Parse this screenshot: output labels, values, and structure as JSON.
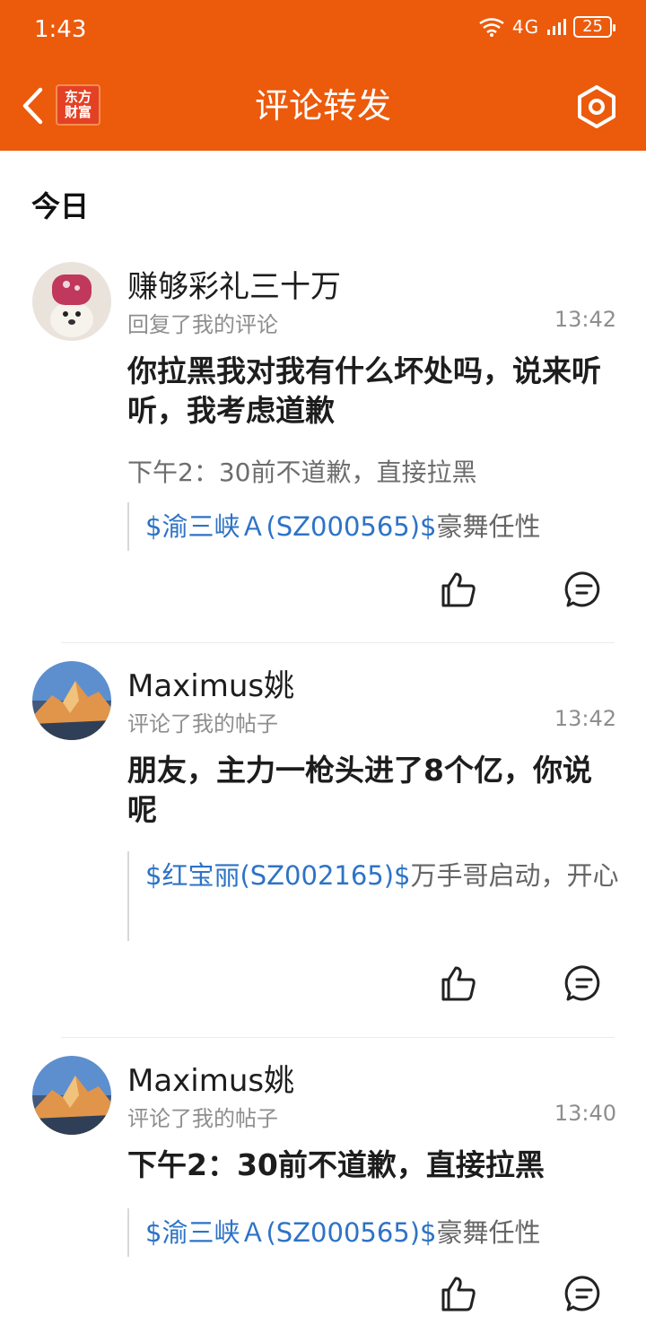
{
  "status_bar": {
    "time": "1:43",
    "network": "4G",
    "battery": "25"
  },
  "header": {
    "logo_line1": "东方",
    "logo_line2": "财富",
    "title": "评论转发"
  },
  "section": {
    "title": "今日"
  },
  "colors": {
    "brand": "#ec5a0b",
    "stock_link": "#2d73c6"
  },
  "items": [
    {
      "name": "赚够彩礼三十万",
      "action_text": "回复了我的评论",
      "time": "13:42",
      "content": "你拉黑我对我有什么坏处吗，说来听听，我考虑道歉",
      "reply": "下午2：30前不道歉，直接拉黑",
      "quote_stock": "$渝三峡Ａ(SZ000565)$",
      "quote_text": "豪舞任性"
    },
    {
      "name": "Maximus姚",
      "action_text": "评论了我的帖子",
      "time": "13:42",
      "content": "朋友，主力一枪头进了8个亿，你说呢",
      "quote_stock": "$红宝丽(SZ002165)$",
      "quote_text": "万手哥启动，开心"
    },
    {
      "name": "Maximus姚",
      "action_text": "评论了我的帖子",
      "time": "13:40",
      "content": "下午2：30前不道歉，直接拉黑",
      "quote_stock": "$渝三峡Ａ(SZ000565)$",
      "quote_text": "豪舞任性"
    }
  ]
}
